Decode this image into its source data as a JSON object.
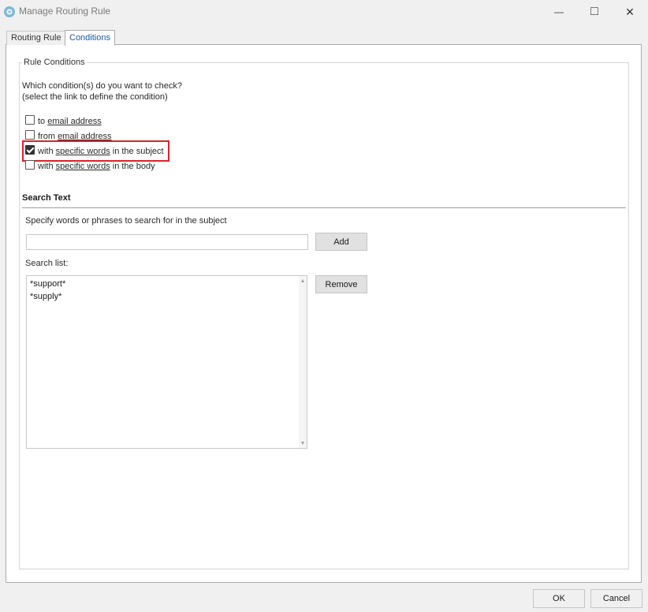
{
  "window": {
    "title": "Manage Routing Rule",
    "minimize_glyph": "—",
    "maximize_glyph": "□",
    "close_glyph": "✕"
  },
  "tabs": [
    {
      "label": "Routing Rule",
      "active": false
    },
    {
      "label": "Conditions",
      "active": true
    }
  ],
  "rule_conditions": {
    "legend": "Rule Conditions",
    "prompt_line1": "Which condition(s) do you want to check?",
    "prompt_line2": "(select the link to define the condition)",
    "options": [
      {
        "prefix": "to ",
        "link": "email address",
        "suffix": "",
        "checked": false
      },
      {
        "prefix": "from ",
        "link": "email address",
        "suffix": "",
        "checked": false
      },
      {
        "prefix": "with ",
        "link": "specific words",
        "suffix": " in the subject",
        "checked": true
      },
      {
        "prefix": "with ",
        "link": "specific words",
        "suffix": " in the body",
        "checked": false
      }
    ]
  },
  "search_text": {
    "title": "Search Text",
    "instruction": "Specify words or phrases to search for in the subject",
    "input_value": "",
    "add_label": "Add",
    "list_label": "Search list:",
    "items": [
      "*support*",
      "*supply*"
    ],
    "remove_label": "Remove"
  },
  "footer": {
    "ok_label": "OK",
    "cancel_label": "Cancel"
  },
  "colors": {
    "highlight": "#d9232e",
    "active_tab_text": "#1a5aa0"
  }
}
